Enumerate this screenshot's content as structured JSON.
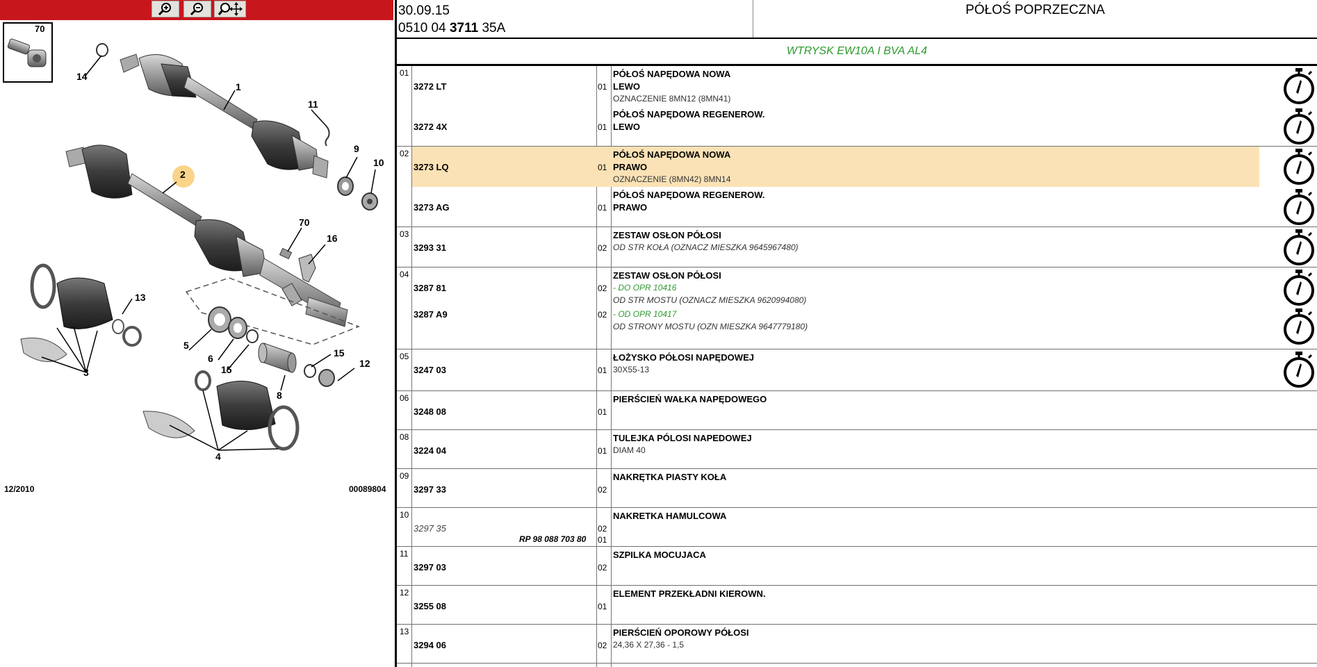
{
  "diagram": {
    "date": "12/2010",
    "code": "00089804",
    "inset_label": "70",
    "callouts": [
      "1",
      "2",
      "3",
      "4",
      "5",
      "6",
      "8",
      "9",
      "10",
      "11",
      "12",
      "13",
      "14",
      "15",
      "15",
      "16",
      "70"
    ],
    "highlight_callout": "2"
  },
  "header": {
    "date": "30.09.15",
    "ref_prefix": "0510 04",
    "ref_bold": "3711",
    "ref_suffix": "35A",
    "title": "PÓŁOŚ POPRZECZNA",
    "engine": "WTRYSK EW10A I BVA AL4"
  },
  "groups": [
    {
      "num": "01",
      "rows": [
        {
          "part": "3272 LT",
          "qty": "01",
          "title": "PÓŁOŚ NAPĘDOWA NOWA",
          "lines": [
            {
              "t": "LEWO",
              "s": "bold"
            },
            {
              "t": "OZNACZENIE 8MN12 (8MN41)",
              "s": "normal"
            }
          ]
        },
        {
          "part": "3272 4X",
          "qty": "01",
          "title": "PÓŁOŚ NAPĘDOWA REGENEROW.",
          "lines": [
            {
              "t": "LEWO",
              "s": "bold"
            }
          ]
        }
      ]
    },
    {
      "num": "02",
      "rows": [
        {
          "part": "3273 LQ",
          "qty": "01",
          "title": "PÓŁOŚ NAPĘDOWA NOWA",
          "lines": [
            {
              "t": "PRAWO",
              "s": "bold"
            },
            {
              "t": "OZNACZENIE (8MN42) 8MN14",
              "s": "normal"
            }
          ]
        },
        {
          "part": "3273 AG",
          "qty": "01",
          "title": "PÓŁOŚ NAPĘDOWA REGENEROW.",
          "lines": [
            {
              "t": "PRAWO",
              "s": "bold"
            }
          ]
        }
      ]
    },
    {
      "num": "03",
      "rows": [
        {
          "part": "3293 31",
          "qty": "02",
          "title": "ZESTAW OSŁON PÓŁOSI",
          "lines": [
            {
              "t": "OD STR KOŁA (OZNACZ MIESZKA 9645967480)",
              "s": "italic"
            }
          ]
        }
      ]
    },
    {
      "num": "04",
      "rows": [
        {
          "part": "3287 81",
          "qty": "02",
          "title": "ZESTAW OSŁON PÓŁOSI",
          "lines": [
            {
              "t": "- DO OPR 10416",
              "s": "green"
            },
            {
              "t": "OD STR MOSTU (OZNACZ MIESZKA 9620994080)",
              "s": "italic"
            }
          ]
        },
        {
          "part": "3287 A9",
          "qty": "02",
          "title": "",
          "lines": [
            {
              "t": "- OD OPR 10417",
              "s": "green"
            },
            {
              "t": "OD STRONY MOSTU (OZN MIESZKA 9647779180)",
              "s": "italic"
            }
          ]
        }
      ]
    },
    {
      "num": "05",
      "rows": [
        {
          "part": "3247 03",
          "qty": "01",
          "title": "ŁOŻYSKO PÓŁOSI NAPĘDOWEJ",
          "lines": [
            {
              "t": "30X55-13",
              "s": "normal"
            }
          ]
        }
      ]
    },
    {
      "num": "06",
      "rows": [
        {
          "part": "3248 08",
          "qty": "01",
          "title": "PIERŚCIEŃ WAŁKA NAPĘDOWEGO",
          "lines": []
        }
      ]
    },
    {
      "num": "08",
      "rows": [
        {
          "part": "3224 04",
          "qty": "01",
          "title": "TULEJKA PÓLOSI NAPEDOWEJ",
          "lines": [
            {
              "t": "DIAM 40",
              "s": "normal"
            }
          ]
        }
      ]
    },
    {
      "num": "09",
      "rows": [
        {
          "part": "3297 33",
          "qty": "02",
          "title": "NAKRĘTKA PIASTY KOŁA",
          "lines": []
        }
      ]
    },
    {
      "num": "10",
      "rows": [
        {
          "part": "3297 35",
          "qty": "02",
          "title": "NAKRETKA HAMULCOWA",
          "lines": []
        }
      ],
      "rp": "RP 98 088 703 80",
      "rp_qty": "01"
    },
    {
      "num": "11",
      "rows": [
        {
          "part": "3297 03",
          "qty": "02",
          "title": "SZPILKA MOCUJACA",
          "lines": []
        }
      ]
    },
    {
      "num": "12",
      "rows": [
        {
          "part": "3255 08",
          "qty": "01",
          "title": "ELEMENT PRZEKŁADNI KIEROWN.",
          "lines": []
        }
      ]
    },
    {
      "num": "13",
      "rows": [
        {
          "part": "3294 06",
          "qty": "02",
          "title": "PIERŚCIEŃ OPOROWY PÓŁOSI",
          "lines": [
            {
              "t": "24,36 X 27,36 - 1,5",
              "s": "normal"
            }
          ]
        }
      ]
    }
  ],
  "colors": {
    "toolbar": "#c8161d",
    "highlight": "#fbe2b6",
    "green": "#2e9a2e"
  }
}
